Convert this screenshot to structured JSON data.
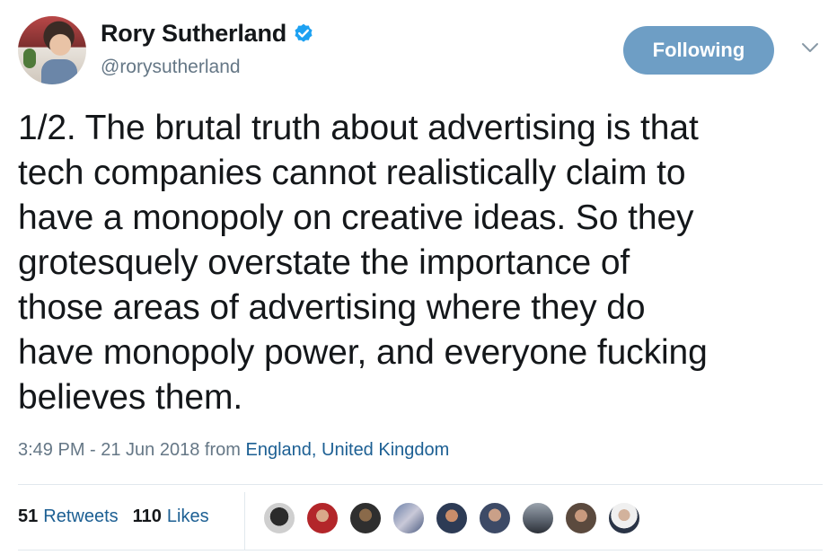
{
  "user": {
    "display_name": "Rory Sutherland",
    "handle": "@rorysutherland",
    "verified_icon": "verified-badge-icon"
  },
  "follow_button": {
    "label": "Following"
  },
  "menu": {
    "icon": "chevron-down-icon"
  },
  "tweet": {
    "lines": [
      "1/2. The brutal truth about advertising is that",
      "tech companies cannot realistically claim to",
      "have a monopoly on creative ideas. So they",
      "grotesquely overstate the importance of",
      "those areas of advertising where they do",
      "have monopoly power, and everyone fucking",
      "believes them."
    ]
  },
  "meta": {
    "time": "3:49 PM - 21 Jun 2018",
    "from": " from ",
    "location": "England, United Kingdom"
  },
  "stats": {
    "retweets_count": "51",
    "retweets_label": "Retweets",
    "likes_count": "110",
    "likes_label": "Likes"
  },
  "colors": {
    "accent": "#1c5f93",
    "follow_bg": "#6e9ec5",
    "muted": "#657786",
    "divider": "#e1e8ed",
    "verified": "#1da1f2"
  }
}
